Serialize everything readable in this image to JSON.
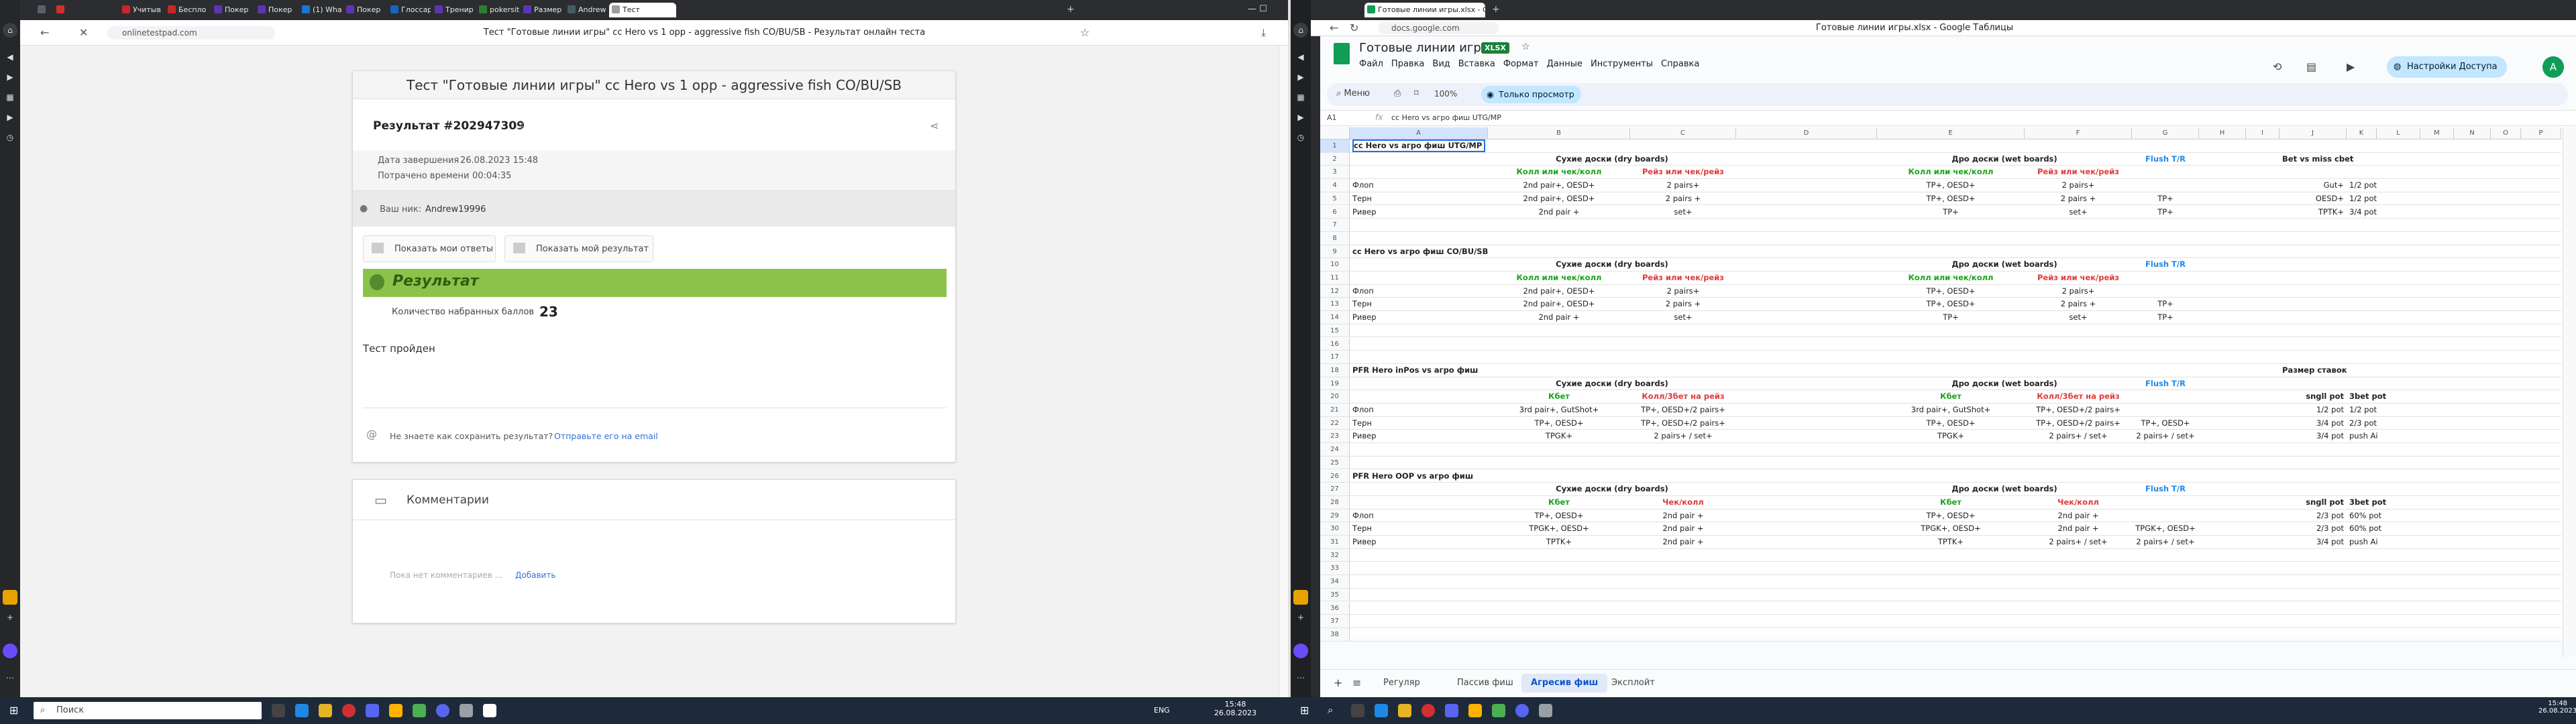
{
  "left_browser": {
    "tabs": [
      {
        "label": "",
        "color": "#5a5f69"
      },
      {
        "label": "",
        "color": "#d32f2f"
      },
      {
        "label": "Учитыв",
        "color": "#c62828"
      },
      {
        "label": "Беспло",
        "color": "#c62828"
      },
      {
        "label": "Покер",
        "color": "#5e35b1"
      },
      {
        "label": "Покер",
        "color": "#5e35b1"
      },
      {
        "label": "(1) What",
        "color": "#1976d2"
      },
      {
        "label": "Покер",
        "color": "#5e35b1"
      },
      {
        "label": "Глоссар",
        "color": "#1565c0"
      },
      {
        "label": "Тренир",
        "color": "#5e35b1"
      },
      {
        "label": "pokersit",
        "color": "#2e7d32"
      },
      {
        "label": "Размер",
        "color": "#5e35b1"
      },
      {
        "label": "Andrew",
        "color": "#455a64"
      },
      {
        "label": "Тест",
        "color": "#9e9e9e"
      }
    ],
    "page_title": "Тест \"Готовые линии игры\" cc Hero vs 1 opp - aggressive fish CO/BU/SB - Результат онлайн теста",
    "url": "onlinetestpad.com"
  },
  "test": {
    "title": "Тест \"Готовые линии игры\" cc Hero vs 1 opp - aggressive fish CO/BU/SB",
    "result_id": "Результат #202947309",
    "completed_label": "Дата завершения",
    "completed_value": "26.08.2023 15:48",
    "time_label": "Потрачено времени",
    "time_value": "00:04:35",
    "user_prefix": "Ваш ник:",
    "user_name": "Andrew19996",
    "btn_answers": "Показать мои ответы",
    "btn_result": "Показать мой результат",
    "result_header": "Результат",
    "score_label": "Количество набранных баллов",
    "score_value": "23",
    "passed": "Тест пройден",
    "save_q": "Не знаете как сохранить результат?",
    "save_link": "Отправьте его на email",
    "comments_title": "Комментарии",
    "no_comments": "Пока нет комментариев ...",
    "add": "Добавить"
  },
  "right_browser": {
    "tab_title": "Готовые линии игры.xlsx - Google Таблицы",
    "url": "docs.google.com",
    "window_title": "Готовые линии игры.xlsx - Google Таблицы"
  },
  "sheets": {
    "doc_title": "Готовые линии игры",
    "badge": "XLSX",
    "menu": [
      "Файл",
      "Правка",
      "Вид",
      "Вставка",
      "Формат",
      "Данные",
      "Инструменты",
      "Справка"
    ],
    "access_btn": "Настройки Доступа",
    "avatar": "A",
    "toolbar_menu": "Меню",
    "zoom": "100%",
    "view_only": "Только просмотр",
    "cell_ref": "A1",
    "formula": "cc Hero vs агро фиш UTG/MP",
    "cols": [
      "A",
      "B",
      "C",
      "D",
      "E",
      "F",
      "G",
      "H",
      "I",
      "J",
      "K",
      "L",
      "M",
      "N",
      "O",
      "P"
    ],
    "rows": [
      {
        "n": "1",
        "cells": [
          {
            "c": 0,
            "t": "cc Hero vs агро фиш UTG/MP",
            "s": "b"
          }
        ]
      },
      {
        "n": "2",
        "cells": [
          {
            "c": 1,
            "t": "Сухие доски (dry boards)",
            "s": "b c2"
          },
          {
            "c": 4,
            "t": "Дро доски (wet boards)",
            "s": "b c2"
          },
          {
            "c": 6,
            "t": "Flush T/R",
            "s": "bl"
          },
          {
            "c": 9,
            "t": "Bet vs miss cbet",
            "s": "b"
          }
        ]
      },
      {
        "n": "3",
        "cells": [
          {
            "c": 1,
            "t": "Колл или чек/колл",
            "s": "g"
          },
          {
            "c": 2,
            "t": "Рейз или чек/рейз",
            "s": "r"
          },
          {
            "c": 4,
            "t": "Колл или чек/колл",
            "s": "g"
          },
          {
            "c": 5,
            "t": "Рейз или чек/рейз",
            "s": "r"
          }
        ]
      },
      {
        "n": "4",
        "cells": [
          {
            "c": 0,
            "t": "Флоп"
          },
          {
            "c": 1,
            "t": "2nd pair+, OESD+"
          },
          {
            "c": 2,
            "t": "2 pairs+"
          },
          {
            "c": 4,
            "t": "TP+, OESD+"
          },
          {
            "c": 5,
            "t": "2 pairs+"
          },
          {
            "c": 9,
            "t": "Gut+"
          },
          {
            "c": 10,
            "t": "1/2 pot"
          }
        ]
      },
      {
        "n": "5",
        "cells": [
          {
            "c": 0,
            "t": "Терн"
          },
          {
            "c": 1,
            "t": "2nd pair+, OESD+"
          },
          {
            "c": 2,
            "t": "2 pairs +"
          },
          {
            "c": 4,
            "t": "TP+, OESD+"
          },
          {
            "c": 5,
            "t": "2 pairs +"
          },
          {
            "c": 6,
            "t": "TP+"
          },
          {
            "c": 9,
            "t": "OESD+"
          },
          {
            "c": 10,
            "t": "1/2 pot"
          }
        ]
      },
      {
        "n": "6",
        "cells": [
          {
            "c": 0,
            "t": "Ривер"
          },
          {
            "c": 1,
            "t": "2nd pair +"
          },
          {
            "c": 2,
            "t": "set+"
          },
          {
            "c": 4,
            "t": "TP+"
          },
          {
            "c": 5,
            "t": "set+"
          },
          {
            "c": 6,
            "t": "TP+"
          },
          {
            "c": 9,
            "t": "TPTK+"
          },
          {
            "c": 10,
            "t": "3/4 pot"
          }
        ]
      },
      {
        "n": "7",
        "cells": []
      },
      {
        "n": "8",
        "cells": []
      },
      {
        "n": "9",
        "cells": [
          {
            "c": 0,
            "t": "cc Hero vs агро фиш CO/BU/SB",
            "s": "b"
          }
        ]
      },
      {
        "n": "10",
        "cells": [
          {
            "c": 1,
            "t": "Сухие доски (dry boards)",
            "s": "b c2"
          },
          {
            "c": 4,
            "t": "Дро доски (wet boards)",
            "s": "b c2"
          },
          {
            "c": 6,
            "t": "Flush T/R",
            "s": "bl"
          }
        ]
      },
      {
        "n": "11",
        "cells": [
          {
            "c": 1,
            "t": "Колл или чек/колл",
            "s": "g"
          },
          {
            "c": 2,
            "t": "Рейз или чек/рейз",
            "s": "r"
          },
          {
            "c": 4,
            "t": "Колл или чек/колл",
            "s": "g"
          },
          {
            "c": 5,
            "t": "Рейз или чек/рейз",
            "s": "r"
          }
        ]
      },
      {
        "n": "12",
        "cells": [
          {
            "c": 0,
            "t": "Флоп"
          },
          {
            "c": 1,
            "t": "2nd pair+, OESD+"
          },
          {
            "c": 2,
            "t": "2 pairs+"
          },
          {
            "c": 4,
            "t": "TP+, OESD+"
          },
          {
            "c": 5,
            "t": "2 pairs+"
          }
        ]
      },
      {
        "n": "13",
        "cells": [
          {
            "c": 0,
            "t": "Терн"
          },
          {
            "c": 1,
            "t": "2nd pair+, OESD+"
          },
          {
            "c": 2,
            "t": "2 pairs +"
          },
          {
            "c": 4,
            "t": "TP+, OESD+"
          },
          {
            "c": 5,
            "t": "2 pairs +"
          },
          {
            "c": 6,
            "t": "TP+"
          }
        ]
      },
      {
        "n": "14",
        "cells": [
          {
            "c": 0,
            "t": "Ривер"
          },
          {
            "c": 1,
            "t": "2nd pair +"
          },
          {
            "c": 2,
            "t": "set+"
          },
          {
            "c": 4,
            "t": "TP+"
          },
          {
            "c": 5,
            "t": "set+"
          },
          {
            "c": 6,
            "t": "TP+"
          }
        ]
      },
      {
        "n": "15",
        "cells": []
      },
      {
        "n": "16",
        "cells": []
      },
      {
        "n": "17",
        "cells": []
      },
      {
        "n": "18",
        "cells": [
          {
            "c": 0,
            "t": "PFR Hero inPos vs  агро фиш",
            "s": "b"
          },
          {
            "c": 9,
            "t": "Размер ставок",
            "s": "b"
          }
        ]
      },
      {
        "n": "19",
        "cells": [
          {
            "c": 1,
            "t": "Сухие доски (dry boards)",
            "s": "b c2"
          },
          {
            "c": 4,
            "t": "Дро доски (wet boards)",
            "s": "b c2"
          },
          {
            "c": 6,
            "t": "Flush T/R",
            "s": "bl"
          }
        ]
      },
      {
        "n": "20",
        "cells": [
          {
            "c": 1,
            "t": "Кбет",
            "s": "g"
          },
          {
            "c": 2,
            "t": "Колл/3бет на рейз",
            "s": "r"
          },
          {
            "c": 4,
            "t": "Кбет",
            "s": "g"
          },
          {
            "c": 5,
            "t": "Колл/3бет на рейз",
            "s": "r"
          },
          {
            "c": 9,
            "t": "sngll pot",
            "s": "b"
          },
          {
            "c": 10,
            "t": "3bet pot",
            "s": "b"
          }
        ]
      },
      {
        "n": "21",
        "cells": [
          {
            "c": 0,
            "t": "Флоп"
          },
          {
            "c": 1,
            "t": "3rd pair+, GutShot+"
          },
          {
            "c": 2,
            "t": "TP+, OESD+/2 pairs+"
          },
          {
            "c": 4,
            "t": "3rd pair+, GutShot+"
          },
          {
            "c": 5,
            "t": "TP+, OESD+/2 pairs+"
          },
          {
            "c": 9,
            "t": "1/2 pot"
          },
          {
            "c": 10,
            "t": "1/2 pot"
          }
        ]
      },
      {
        "n": "22",
        "cells": [
          {
            "c": 0,
            "t": "Терн"
          },
          {
            "c": 1,
            "t": "TP+, OESD+"
          },
          {
            "c": 2,
            "t": "TP+, OESD+/2 pairs+"
          },
          {
            "c": 4,
            "t": "TP+, OESD+"
          },
          {
            "c": 5,
            "t": "TP+, OESD+/2 pairs+"
          },
          {
            "c": 6,
            "t": "TP+, OESD+"
          },
          {
            "c": 9,
            "t": "3/4 pot"
          },
          {
            "c": 10,
            "t": "2/3 pot"
          }
        ]
      },
      {
        "n": "23",
        "cells": [
          {
            "c": 0,
            "t": "Ривер"
          },
          {
            "c": 1,
            "t": "TPGK+"
          },
          {
            "c": 2,
            "t": "2 pairs+ / set+"
          },
          {
            "c": 4,
            "t": "TPGK+"
          },
          {
            "c": 5,
            "t": "2 pairs+ / set+"
          },
          {
            "c": 6,
            "t": "2 pairs+ / set+"
          },
          {
            "c": 9,
            "t": "3/4 pot"
          },
          {
            "c": 10,
            "t": "push Ai"
          }
        ]
      },
      {
        "n": "24",
        "cells": []
      },
      {
        "n": "25",
        "cells": []
      },
      {
        "n": "26",
        "cells": [
          {
            "c": 0,
            "t": "PFR Hero OOP vs агро фиш",
            "s": "b"
          }
        ]
      },
      {
        "n": "27",
        "cells": [
          {
            "c": 1,
            "t": "Сухие доски (dry boards)",
            "s": "b c2"
          },
          {
            "c": 4,
            "t": "Дро доски (wet boards)",
            "s": "b c2"
          },
          {
            "c": 6,
            "t": "Flush T/R",
            "s": "bl"
          }
        ]
      },
      {
        "n": "28",
        "cells": [
          {
            "c": 1,
            "t": "Кбет",
            "s": "g"
          },
          {
            "c": 2,
            "t": "Чек/колл",
            "s": "r"
          },
          {
            "c": 4,
            "t": "Кбет",
            "s": "g"
          },
          {
            "c": 5,
            "t": "Чек/колл",
            "s": "r"
          },
          {
            "c": 9,
            "t": "sngll pot",
            "s": "b"
          },
          {
            "c": 10,
            "t": "3bet pot",
            "s": "b"
          }
        ]
      },
      {
        "n": "29",
        "cells": [
          {
            "c": 0,
            "t": "Флоп"
          },
          {
            "c": 1,
            "t": "TP+, OESD+"
          },
          {
            "c": 2,
            "t": "2nd pair +"
          },
          {
            "c": 4,
            "t": "TP+, OESD+"
          },
          {
            "c": 5,
            "t": "2nd pair +"
          },
          {
            "c": 9,
            "t": "2/3 pot"
          },
          {
            "c": 10,
            "t": "60% pot"
          }
        ]
      },
      {
        "n": "30",
        "cells": [
          {
            "c": 0,
            "t": "Терн"
          },
          {
            "c": 1,
            "t": "TPGK+, OESD+"
          },
          {
            "c": 2,
            "t": "2nd pair +"
          },
          {
            "c": 4,
            "t": "TPGK+, OESD+"
          },
          {
            "c": 5,
            "t": "2nd pair +"
          },
          {
            "c": 6,
            "t": "TPGK+, OESD+"
          },
          {
            "c": 9,
            "t": "2/3 pot"
          },
          {
            "c": 10,
            "t": "60% pot"
          }
        ]
      },
      {
        "n": "31",
        "cells": [
          {
            "c": 0,
            "t": "Ривер"
          },
          {
            "c": 1,
            "t": "TPTK+"
          },
          {
            "c": 2,
            "t": "2nd pair +"
          },
          {
            "c": 4,
            "t": "TPTK+"
          },
          {
            "c": 5,
            "t": "2 pairs+ / set+"
          },
          {
            "c": 6,
            "t": "2 pairs+ / set+"
          },
          {
            "c": 9,
            "t": "3/4 pot"
          },
          {
            "c": 10,
            "t": "push Ai"
          }
        ]
      },
      {
        "n": "32",
        "cells": []
      },
      {
        "n": "33",
        "cells": []
      },
      {
        "n": "34",
        "cells": []
      },
      {
        "n": "35",
        "cells": []
      },
      {
        "n": "36",
        "cells": []
      },
      {
        "n": "37",
        "cells": []
      },
      {
        "n": "38",
        "cells": []
      }
    ],
    "sheet_tabs": [
      "Регуляр",
      "Пассив фиш",
      "Агресив фиш",
      "Эксплойт"
    ],
    "active_sheet": "Агресив фиш"
  },
  "taskbar_left": {
    "search": "Поиск",
    "lang": "ENG",
    "time": "15:48",
    "date": "26.08.2023"
  },
  "taskbar_right": {
    "time": "15:48",
    "date": "26.08.2023"
  }
}
